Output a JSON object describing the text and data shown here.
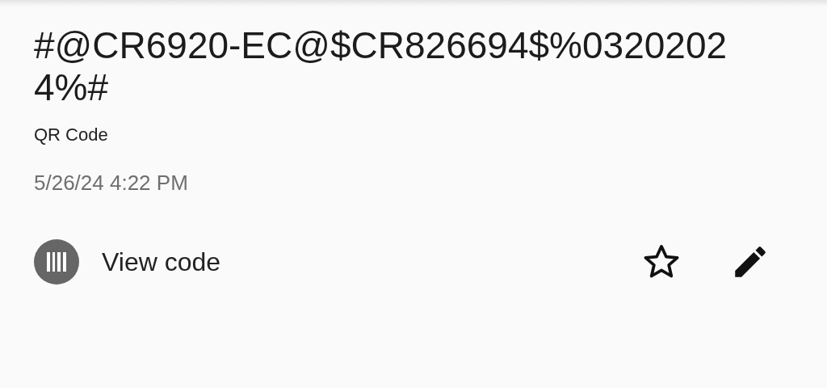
{
  "item": {
    "content": "#@CR6920-EC@$CR826694$%03202024%#",
    "format": "QR Code",
    "date": "5/26/24 4:22 PM",
    "starred": false
  },
  "action": {
    "label": "View code"
  }
}
